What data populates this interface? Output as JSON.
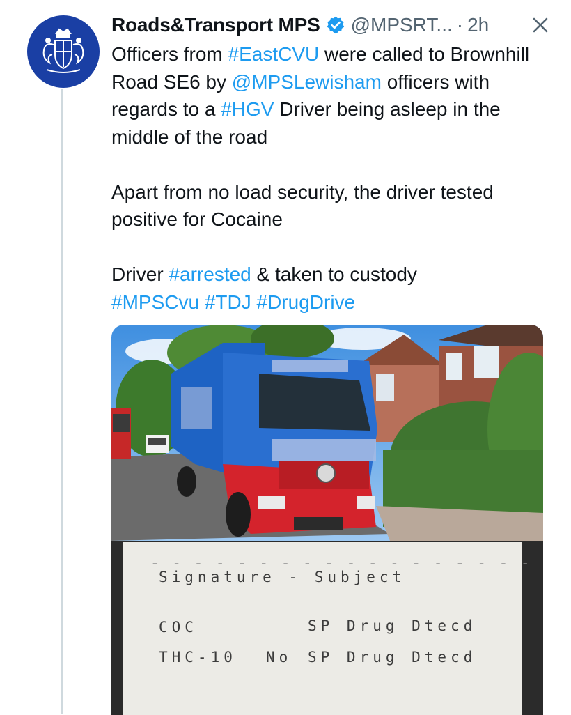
{
  "tweet": {
    "display_name": "Roads&Transport MPS",
    "handle": "@MPSRT...",
    "separator": "·",
    "time": "2h",
    "paragraphs": [
      [
        {
          "t": "Officers from "
        },
        {
          "t": "#EastCVU",
          "link": true
        },
        {
          "t": " were called to Brownhill Road SE6 by "
        },
        {
          "t": "@MPSLewisham",
          "link": true
        },
        {
          "t": " officers with regards to a "
        },
        {
          "t": "#HGV",
          "link": true
        },
        {
          "t": " Driver being asleep in the middle of the road"
        }
      ],
      [
        {
          "t": "Apart from no load security, the driver tested positive for Cocaine"
        }
      ],
      [
        {
          "t": "Driver "
        },
        {
          "t": "#arrested",
          "link": true
        },
        {
          "t": " & taken to custody"
        },
        {
          "br": true
        },
        {
          "t": "#MPSCvu",
          "link": true
        },
        {
          "t": " "
        },
        {
          "t": "#TDJ",
          "link": true
        },
        {
          "t": " "
        },
        {
          "t": "#DrugDrive",
          "link": true
        }
      ]
    ]
  },
  "receipt": {
    "header": "Signature - Subject",
    "dashes": "- - - - - - - - - - - - - - - - - - - -",
    "row1_left": "COC",
    "row1_right": "SP Drug Dtecd",
    "row2_left": "THC-10",
    "row2_mid": "No",
    "row2_right": "SP Drug Dtecd"
  },
  "icons": {
    "avatar": "met-police-crest-icon",
    "verified": "verified-badge-icon",
    "close": "close-icon"
  },
  "colors": {
    "link": "#1d9bf0",
    "avatar_bg": "#1a3fa4",
    "muted": "#536471",
    "verified": "#1d9bf0"
  }
}
